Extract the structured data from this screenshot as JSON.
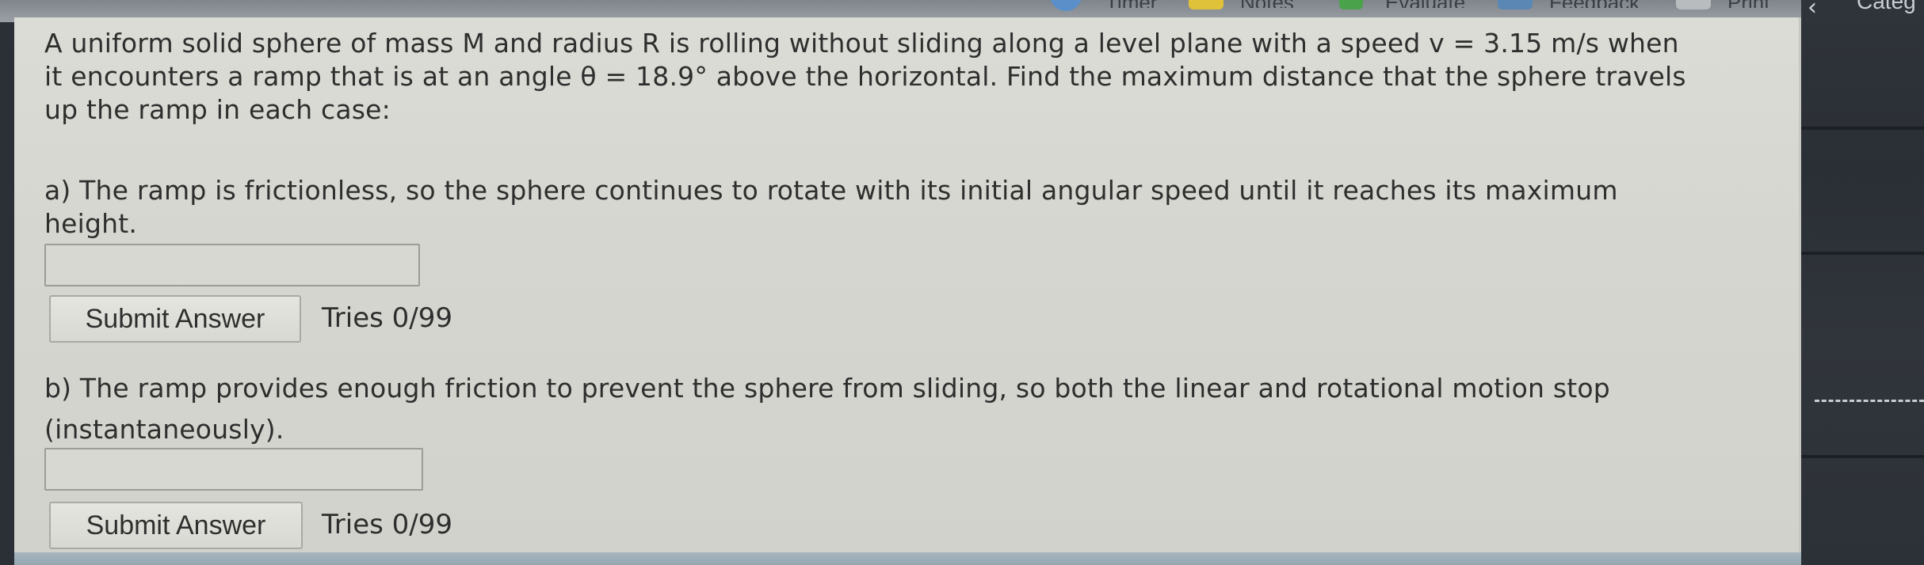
{
  "toolbar": {
    "items": [
      "Timer",
      "Notes",
      "Evaluate",
      "Feedback",
      "Print"
    ],
    "right_label": "Categ"
  },
  "problem": {
    "intro_line1": "A uniform solid sphere of mass M and radius R is rolling without sliding along a level plane with a speed v = 3.15 m/s when",
    "intro_line2": "it encounters a ramp that is at an angle θ = 18.9° above the horizontal. Find the maximum distance that the sphere travels",
    "intro_line3": "up the ramp in each case:"
  },
  "part_a": {
    "text_line1": "a) The ramp is frictionless, so the sphere continues to rotate with its initial angular speed until it reaches its maximum",
    "text_line2": "height.",
    "answer_value": "",
    "submit_label": "Submit Answer",
    "tries": "Tries 0/99"
  },
  "part_b": {
    "text_line1": "b) The ramp provides enough friction to prevent the sphere from sliding, so both the linear and rotational motion stop",
    "text_line2": "(instantaneously).",
    "answer_value": "",
    "submit_label": "Submit Answer",
    "tries": "Tries 0/99"
  },
  "colors": {
    "panel_bg": "#d8d8d2",
    "text": "#2e2e2e",
    "dark_side": "#2b3036"
  }
}
